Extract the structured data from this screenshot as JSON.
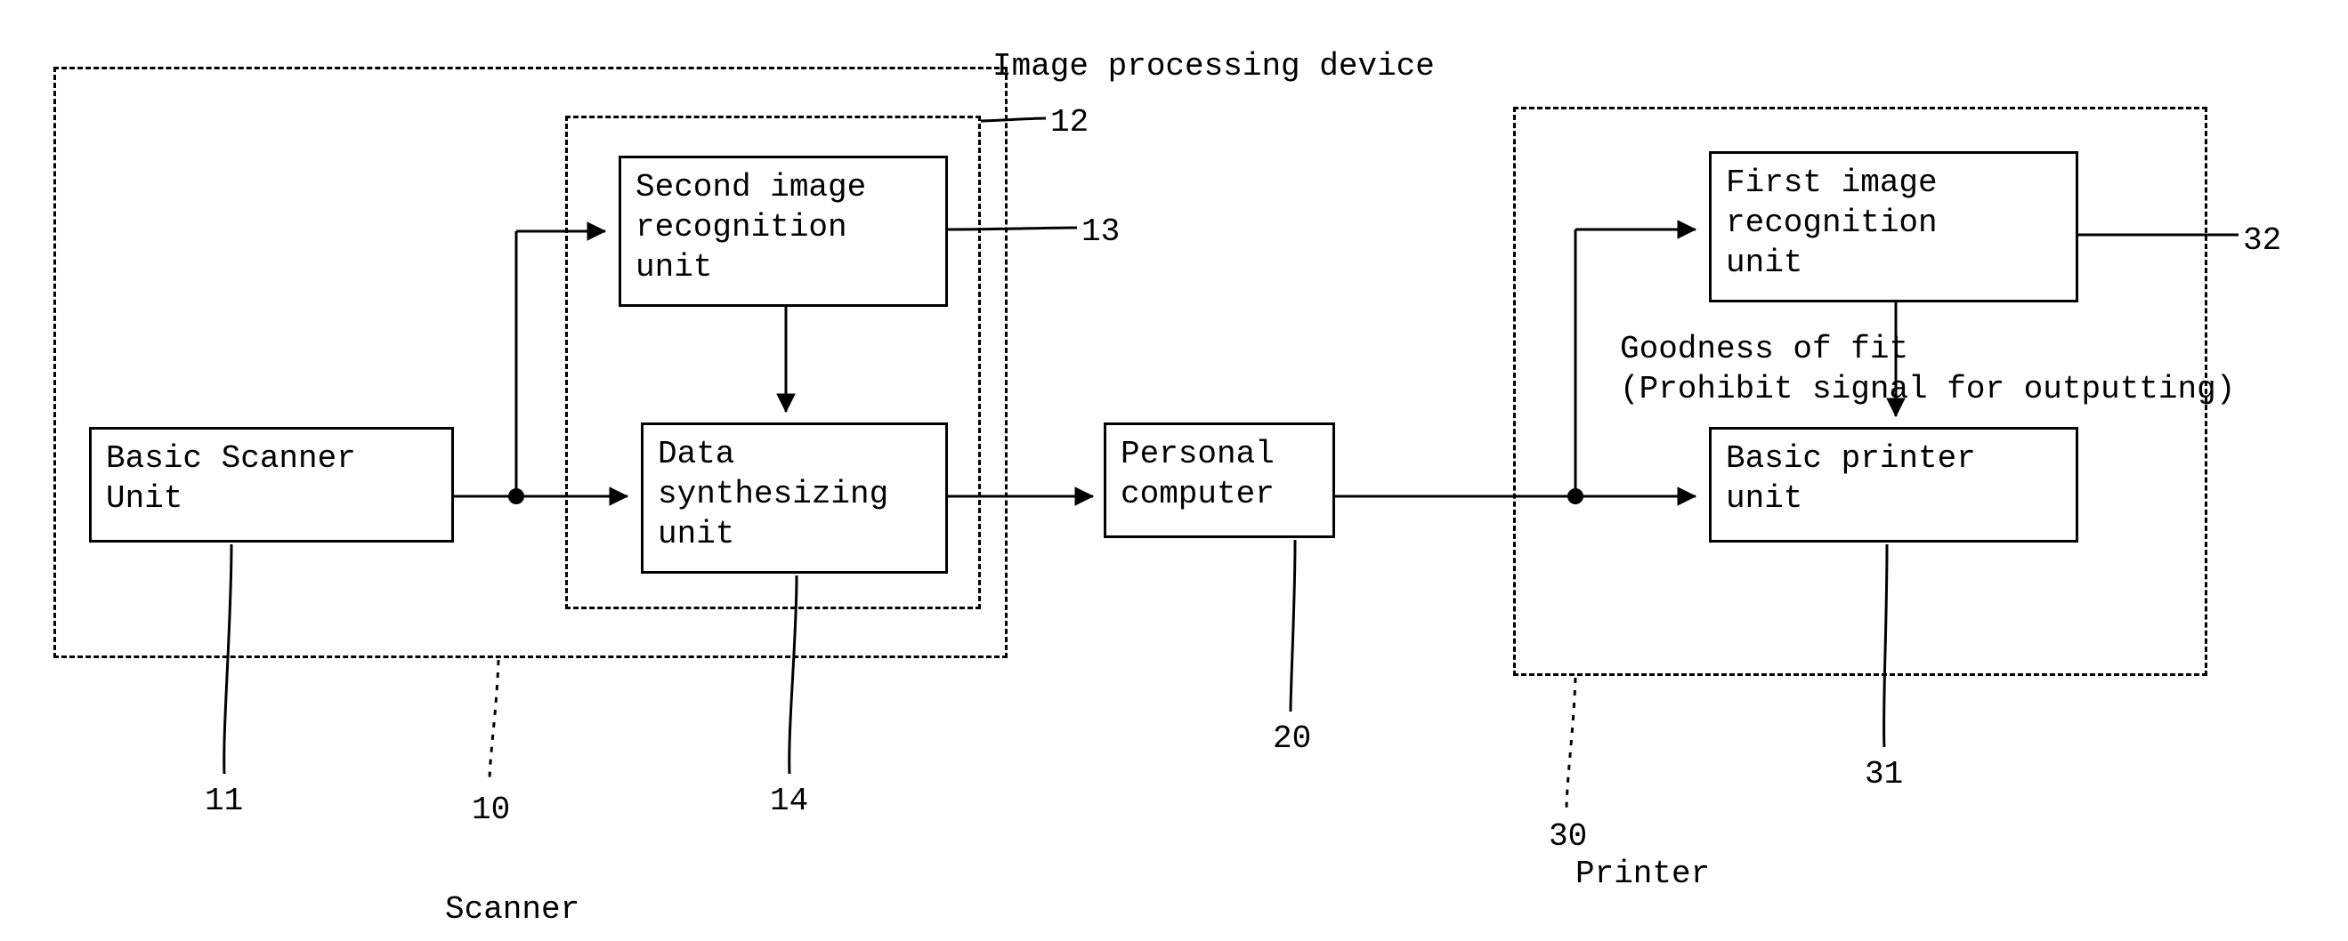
{
  "title_top": "Image processing device",
  "boxes": {
    "scanner_unit": "Basic Scanner\nUnit",
    "second_recog": "Second image\nrecognition\nunit",
    "data_synth": "Data\nsynthesizing\nunit",
    "pc": "Personal\ncomputer",
    "first_recog": "First image\nrecognition\nunit",
    "printer_unit": "Basic printer\nunit"
  },
  "annotations": {
    "goodness": "Goodness of fit\n(Prohibit signal for outputting)"
  },
  "refs": {
    "r10": "10",
    "r11": "11",
    "r12": "12",
    "r13": "13",
    "r14": "14",
    "r20": "20",
    "r30": "30",
    "r31": "31",
    "r32": "32"
  },
  "bottom_labels": {
    "scanner": "Scanner",
    "printer": "Printer"
  }
}
